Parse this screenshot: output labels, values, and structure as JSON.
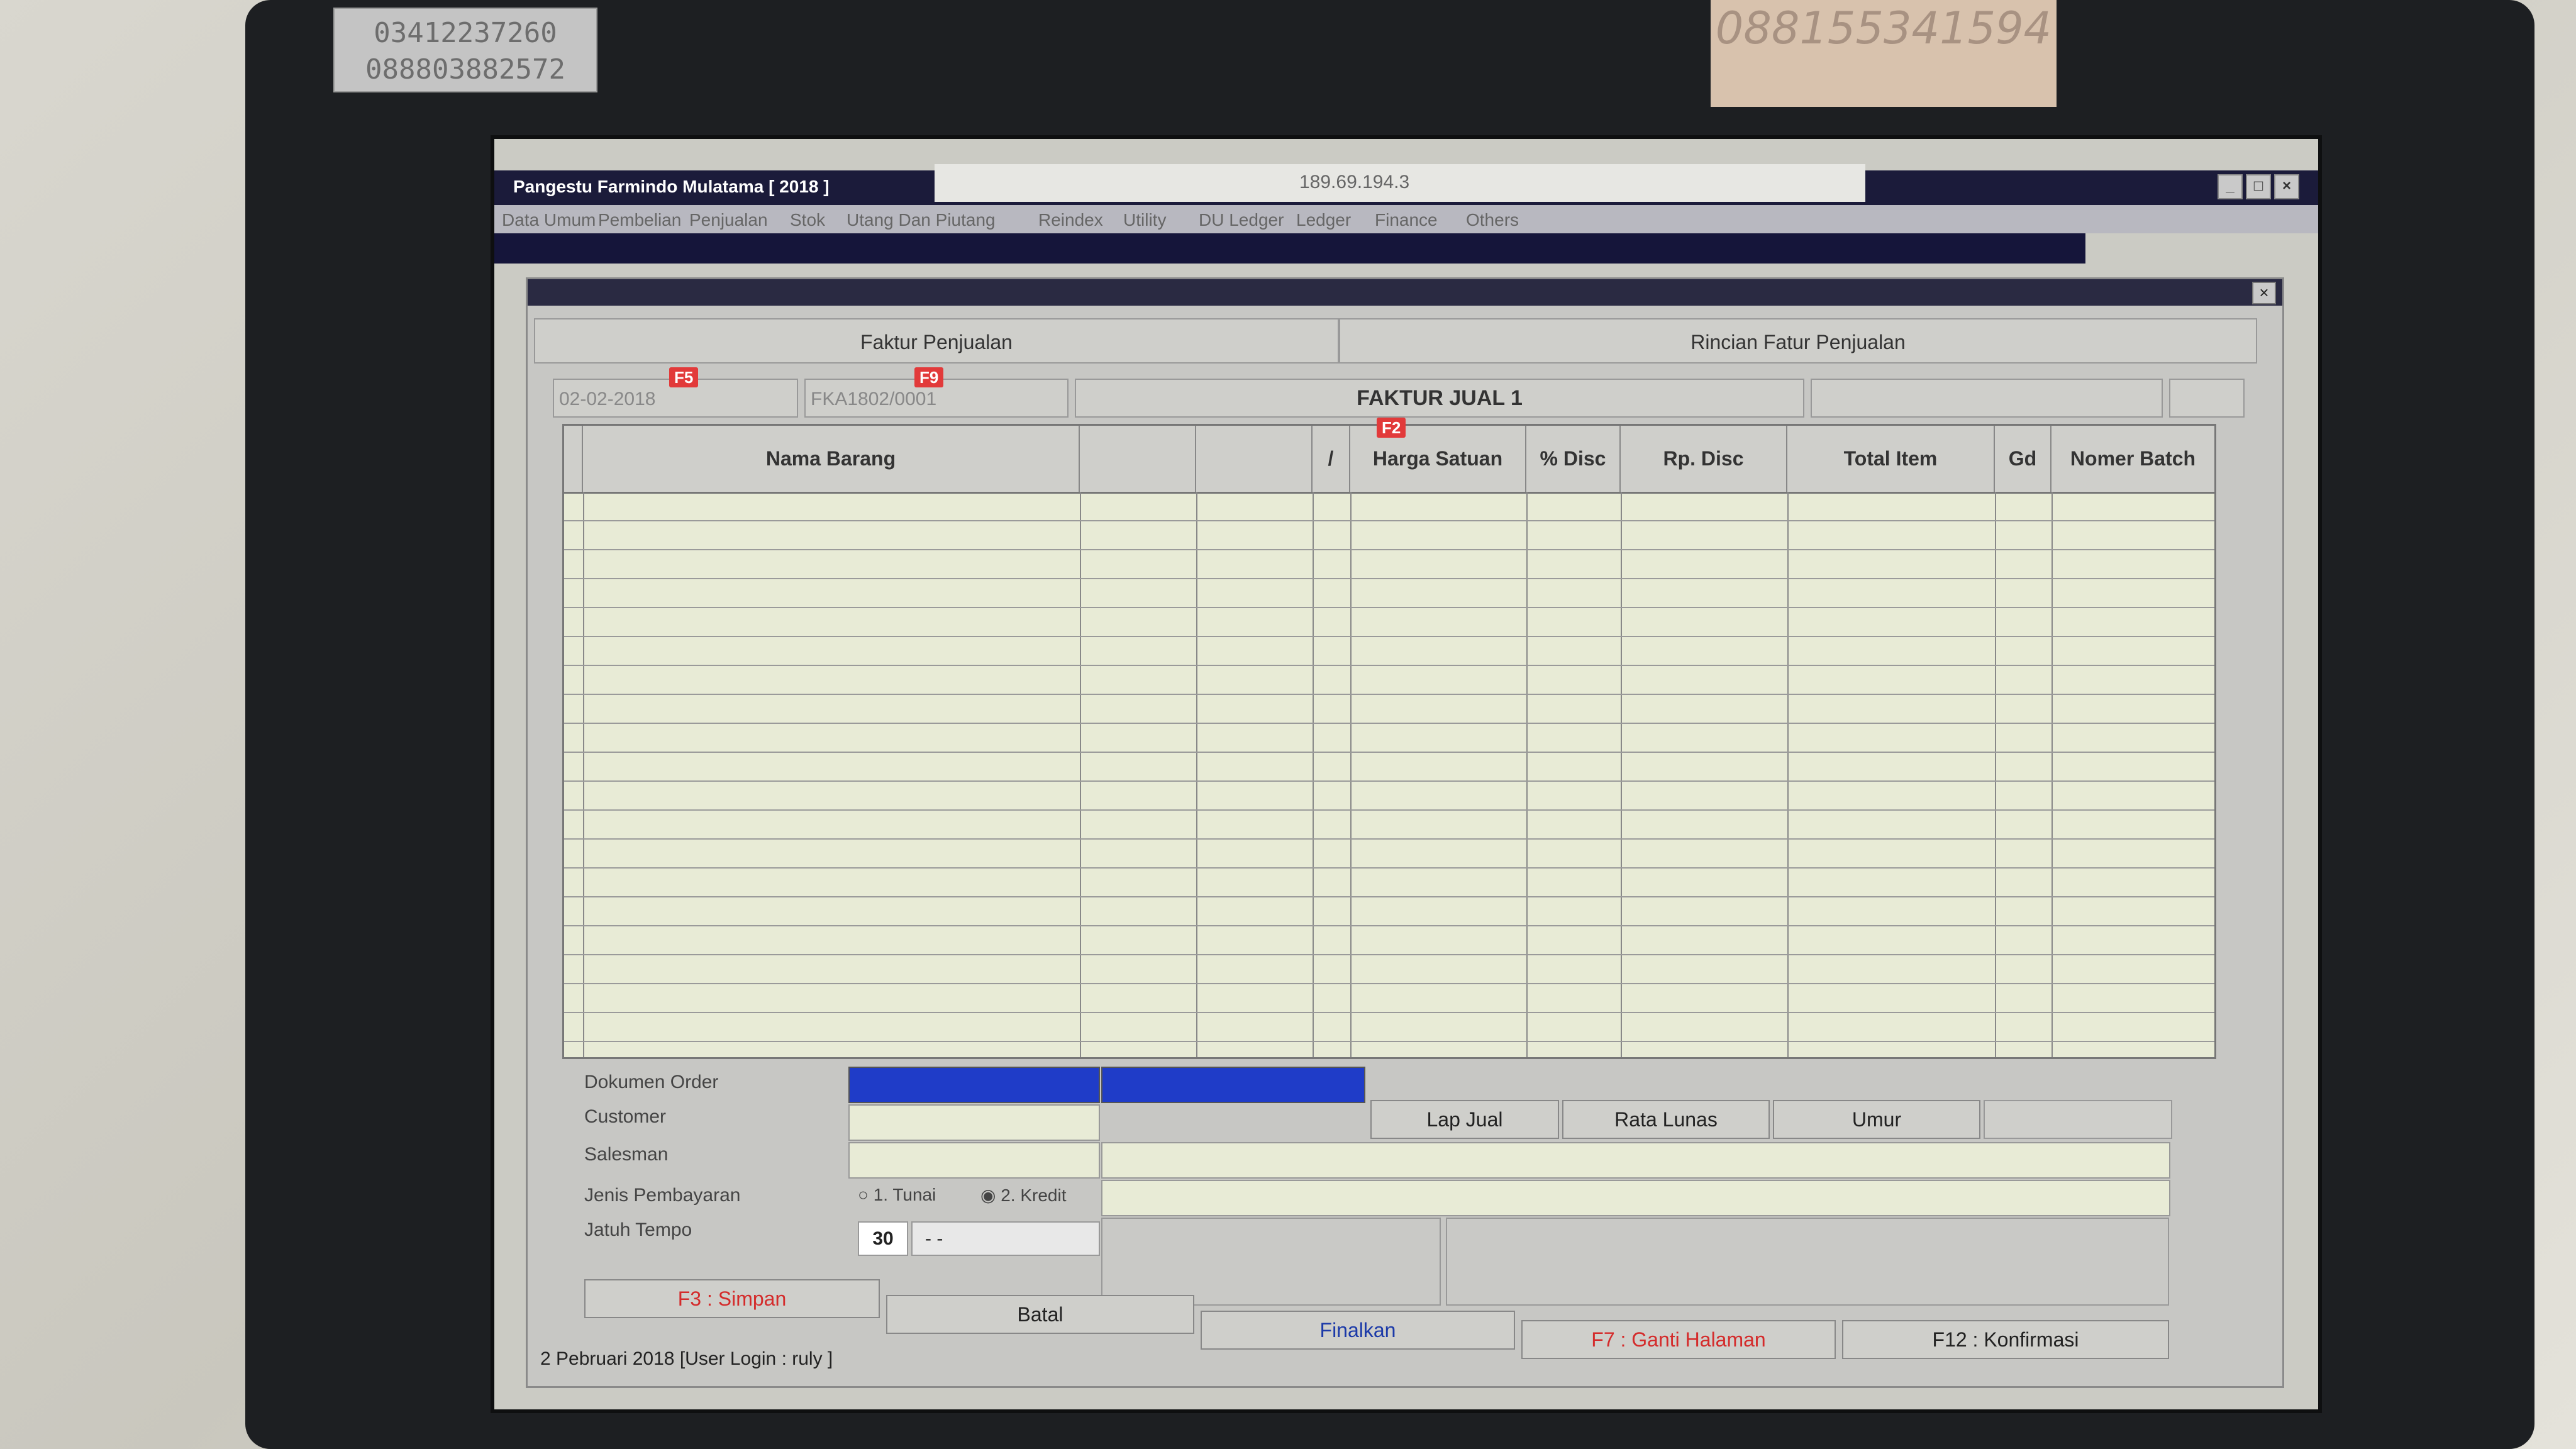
{
  "stickers": {
    "phone_left_1": "03412237260",
    "phone_left_2": "088803882572",
    "phone_right": "088155341594"
  },
  "window": {
    "title": "Pangestu Farmindo Mulatama [ 2018 ]",
    "address": "189.69.194.3"
  },
  "menu": [
    "Data Umum",
    "Pembelian",
    "Penjualan",
    "Stok",
    "Utang Dan Piutang",
    "Reindex",
    "Utility",
    "DU Ledger",
    "Ledger",
    "Finance",
    "Others"
  ],
  "tabs": {
    "faktur": "Faktur Penjualan",
    "rincian": "Rincian Fatur Penjualan"
  },
  "header": {
    "date": "02-02-2018",
    "date_key": "F5",
    "invoice_no": "FKA1802/0001",
    "invoice_key": "F9",
    "form_title": "FAKTUR JUAL 1",
    "grid_key": "F2"
  },
  "grid": {
    "columns": [
      "Nama Barang",
      "",
      "",
      "/",
      "Harga Satuan",
      "% Disc",
      "Rp. Disc",
      "Total Item",
      "Gd",
      "Nomer Batch"
    ]
  },
  "bottom": {
    "dokumen_order_label": "Dokumen Order",
    "customer_label": "Customer",
    "salesman_label": "Salesman",
    "jenis_pembayaran_label": "Jenis Pembayaran",
    "jatuh_tempo_label": "Jatuh Tempo",
    "radio_tunai": "1. Tunai",
    "radio_kredit": "2. Kredit",
    "tempo_days": "30",
    "tempo_date": "- -",
    "lap_jual": "Lap Jual",
    "rata_lunas": "Rata Lunas",
    "umur": "Umur"
  },
  "actions": {
    "simpan": "F3 : Simpan",
    "batal": "Batal",
    "finalkan": "Finalkan",
    "ganti_halaman": "F7 : Ganti Halaman",
    "konfirmasi": "F12 : Konfirmasi"
  },
  "status_bar": "2 Pebruari 2018  [User Login : ruly ]"
}
